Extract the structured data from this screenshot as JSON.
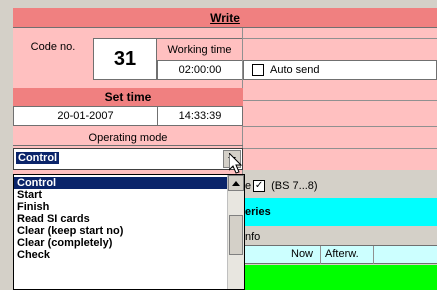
{
  "write_section": {
    "title": "Write",
    "code_label": "Code no.",
    "code_value": "31",
    "working_time_label": "Working time",
    "working_time_value": "02:00:00",
    "auto_send_label": "Auto send"
  },
  "set_time": {
    "title": "Set time",
    "date": "20-01-2007",
    "time": "14:33:39"
  },
  "operating_mode": {
    "title": "Operating mode",
    "selected": "Control",
    "options": [
      "Control",
      "Start",
      "Finish",
      "Read SI cards",
      "Clear (keep start no)",
      "Clear (completely)",
      "Check"
    ]
  },
  "right_panel": {
    "bs_checkbox_prefix": "e",
    "bs_label": "(BS 7...8)",
    "series_label": "eries",
    "info_label": "nfo",
    "now_label": "Now",
    "afterw_label": "Afterw."
  },
  "colors": {
    "pink": "#ffc0c0",
    "salmon": "#f08080",
    "cyan": "#00ffff",
    "green": "#00ff00",
    "selection": "#0a246a"
  }
}
